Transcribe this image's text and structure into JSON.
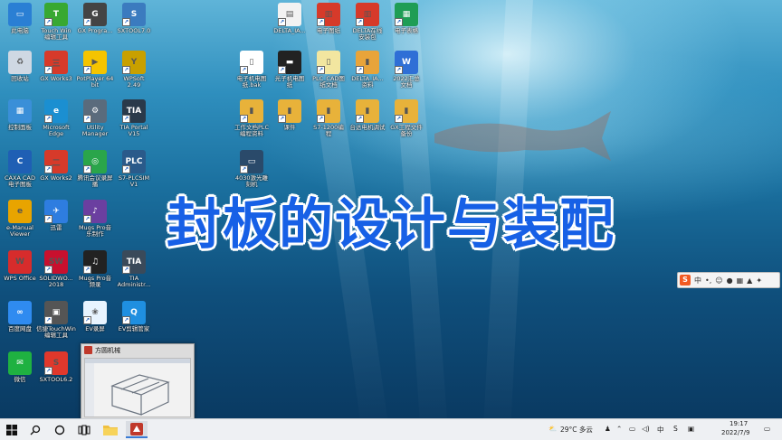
{
  "overlay_title": "封板的设计与装配",
  "desktop_icons": [
    {
      "label": "此电脑",
      "col": 0,
      "row": 0,
      "color": "#2a7fd4",
      "glyph": "▭"
    },
    {
      "label": "回收站",
      "col": 0,
      "row": 1,
      "color": "#cfd8e3",
      "glyph": "♻"
    },
    {
      "label": "控制面板",
      "col": 0,
      "row": 2,
      "color": "#3a8fd8",
      "glyph": "▦"
    },
    {
      "label": "CAXA CAD\n电子图板",
      "col": 0,
      "row": 3,
      "color": "#1f5fb4",
      "glyph": "C"
    },
    {
      "label": "e-Manual\nViewer",
      "col": 0,
      "row": 4,
      "color": "#e8a400",
      "glyph": "e"
    },
    {
      "label": "WPS Office",
      "col": 0,
      "row": 5,
      "color": "#d72c2c",
      "glyph": "W"
    },
    {
      "label": "百度网盘",
      "col": 0,
      "row": 6,
      "color": "#2f8bf0",
      "glyph": "∞"
    },
    {
      "label": "微信",
      "col": 0,
      "row": 7,
      "color": "#1fb141",
      "glyph": "✉"
    },
    {
      "label": "Touch Win\n编辑工具",
      "col": 1,
      "row": 0,
      "color": "#38a832",
      "glyph": "T"
    },
    {
      "label": "GX Works3",
      "col": 1,
      "row": 1,
      "color": "#d63a2a",
      "glyph": "三"
    },
    {
      "label": "Microsoft\nEdge",
      "col": 1,
      "row": 2,
      "color": "#1b8fd1",
      "glyph": "e"
    },
    {
      "label": "GX Works2",
      "col": 1,
      "row": 3,
      "color": "#d63a2a",
      "glyph": "二"
    },
    {
      "label": "迅雷",
      "col": 1,
      "row": 4,
      "color": "#2e7de0",
      "glyph": "✈"
    },
    {
      "label": "SOLIDWO...\n2018",
      "col": 1,
      "row": 5,
      "color": "#c8102e",
      "glyph": "SW"
    },
    {
      "label": "信捷TouchWin\n编辑工具",
      "col": 1,
      "row": 6,
      "color": "#555555",
      "glyph": "▣"
    },
    {
      "label": "SXTOOL6.2",
      "col": 1,
      "row": 7,
      "color": "#e0382c",
      "glyph": "S"
    },
    {
      "label": "GX Progra...",
      "col": 2,
      "row": 0,
      "color": "#444444",
      "glyph": "G"
    },
    {
      "label": "PotPlayer 64\nbit",
      "col": 2,
      "row": 1,
      "color": "#f5c400",
      "glyph": "▶"
    },
    {
      "label": "Utility\nManager",
      "col": 2,
      "row": 2,
      "color": "#5a6b7c",
      "glyph": "⚙"
    },
    {
      "label": "腾讯会议录屏\n播",
      "col": 2,
      "row": 3,
      "color": "#2aa54a",
      "glyph": "◎"
    },
    {
      "label": "Mugs Pro音\n乐制作",
      "col": 2,
      "row": 4,
      "color": "#6b3fa0",
      "glyph": "♪"
    },
    {
      "label": "Mugs Pro音\n频录",
      "col": 2,
      "row": 5,
      "color": "#222222",
      "glyph": "♫"
    },
    {
      "label": "EV录屏",
      "col": 2,
      "row": 6,
      "color": "#e8f4ff",
      "glyph": "❀"
    },
    {
      "label": "SXTOOL7.0",
      "col": 3,
      "row": 0,
      "color": "#3b7bbf",
      "glyph": "S"
    },
    {
      "label": "WPSoft\n2.49",
      "col": 3,
      "row": 1,
      "color": "#c8a000",
      "glyph": "Y"
    },
    {
      "label": "TIA Portal\nV15",
      "col": 3,
      "row": 2,
      "color": "#2a3a4a",
      "glyph": "TIA"
    },
    {
      "label": "S7-PLCSIM\nV1",
      "col": 3,
      "row": 3,
      "color": "#2a5a8a",
      "glyph": "PLC"
    },
    {
      "label": "TIA\nAdministr...",
      "col": 3,
      "row": 5,
      "color": "#3a4a5a",
      "glyph": "TIA"
    },
    {
      "label": "EV剪辑管家",
      "col": 3,
      "row": 6,
      "color": "#1f8fe0",
      "glyph": "Q"
    },
    {
      "label": "DELTA_IA...",
      "col": 7,
      "row": 0,
      "color": "#f2f2f2",
      "glyph": "▤"
    },
    {
      "label": "电子图纸",
      "col": 8,
      "row": 0,
      "color": "#d63a2a",
      "glyph": "▥"
    },
    {
      "label": "DELTA在线\n安装包",
      "col": 9,
      "row": 0,
      "color": "#d63a2a",
      "glyph": "▥"
    },
    {
      "label": "电子表格",
      "col": 10,
      "row": 0,
      "color": "#1f9d55",
      "glyph": "▦"
    },
    {
      "label": "电子机电图\n纸.bak",
      "col": 6,
      "row": 1,
      "color": "#ffffff",
      "glyph": "▯"
    },
    {
      "label": "光子机电图\n纸",
      "col": 7,
      "row": 1,
      "color": "#222222",
      "glyph": "▬"
    },
    {
      "label": "PLC_CAD图\n纸文档",
      "col": 8,
      "row": 1,
      "color": "#f2e6a0",
      "glyph": "▯"
    },
    {
      "label": "DELTA_IA...\n资料",
      "col": 9,
      "row": 1,
      "color": "#e8a43a",
      "glyph": "▮"
    },
    {
      "label": "2022汇总\n文档",
      "col": 10,
      "row": 1,
      "color": "#2f6fd6",
      "glyph": "W"
    },
    {
      "label": "工作文档PLC\n编程资料",
      "col": 6,
      "row": 2,
      "color": "#e8b23a",
      "glyph": "▮"
    },
    {
      "label": "课件",
      "col": 7,
      "row": 2,
      "color": "#e8b23a",
      "glyph": "▮"
    },
    {
      "label": "S7-1200编\n程",
      "col": 8,
      "row": 2,
      "color": "#e8b23a",
      "glyph": "▮"
    },
    {
      "label": "台达电机调试",
      "col": 9,
      "row": 2,
      "color": "#e8b23a",
      "glyph": "▮"
    },
    {
      "label": "GX工程文件\n备份",
      "col": 10,
      "row": 2,
      "color": "#e8b23a",
      "glyph": "▮"
    },
    {
      "label": "4030激光雕\n刻机",
      "col": 6,
      "row": 3,
      "color": "#2a4a6a",
      "glyph": "▭"
    }
  ],
  "ime_bar": {
    "logo": "S",
    "lang": "中"
  },
  "taskbar_preview": {
    "title": "方圆机械"
  },
  "taskbar": {
    "weather": "29°C 多云",
    "ime_lang": "中",
    "time": "19:17",
    "date": "2022/7/9"
  },
  "colors": {
    "title_blue": "#1760e6",
    "taskbar_bg": "#eef0f3"
  }
}
